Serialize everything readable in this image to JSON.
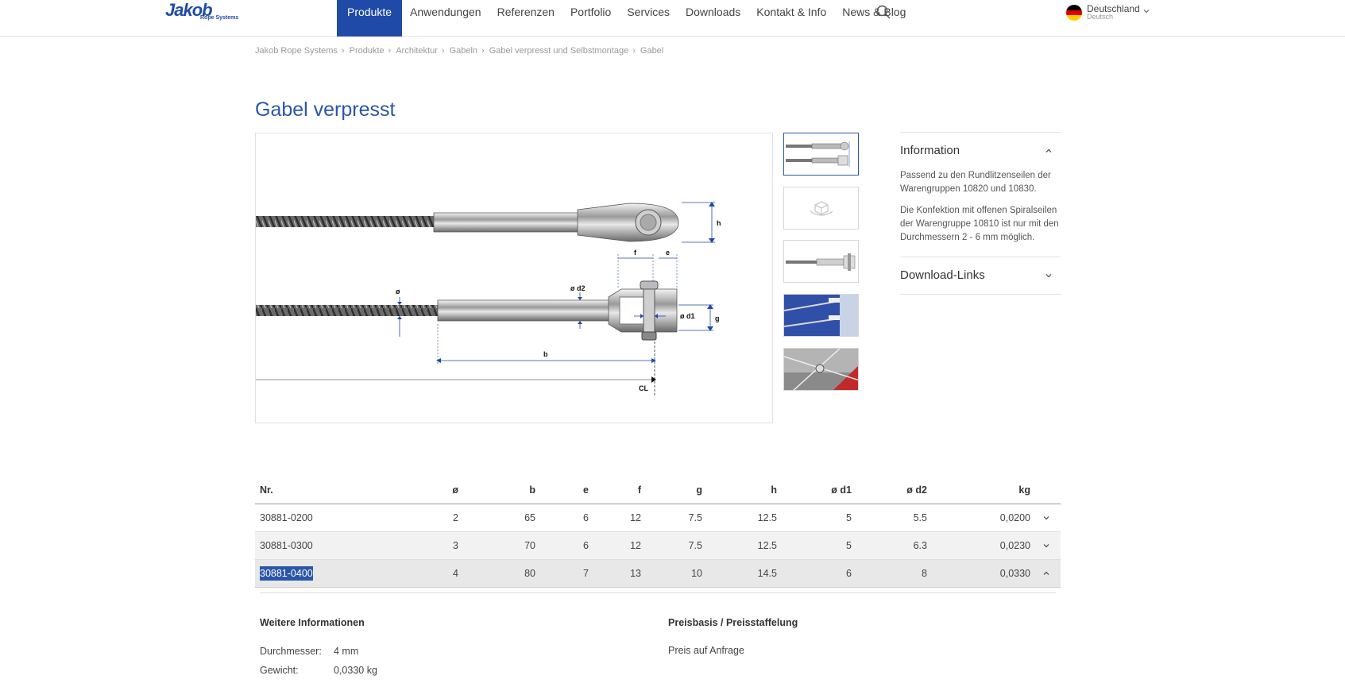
{
  "header": {
    "logo": {
      "name": "Jakob",
      "tagline": "Rope Systems"
    },
    "nav": [
      "Produkte",
      "Anwendungen",
      "Referenzen",
      "Portfolio",
      "Services",
      "Downloads",
      "Kontakt & Info",
      "News & Blog"
    ],
    "active_nav": "Produkte",
    "language": {
      "country": "Deutschland",
      "language": "Deutsch"
    }
  },
  "breadcrumb": [
    "Jakob Rope Systems",
    "Produkte",
    "Architektur",
    "Gabeln",
    "Gabel verpresst und Selbstmontage",
    "Gabel"
  ],
  "page_title": "Gabel verpresst",
  "drawing_labels": {
    "h": "h",
    "f": "f",
    "e": "e",
    "d2": "ø d2",
    "d1": "ø d1",
    "g": "g",
    "dia": "ø",
    "b": "b",
    "cl": "CL"
  },
  "info": {
    "information_title": "Information",
    "paragraphs": [
      "Passend zu den Rundlitzenseilen der Warengruppen 10820 und 10830.",
      "Die Konfektion mit offenen Spiralseilen der Warengruppe 10810 ist nur mit den Durchmessern 2 - 6 mm möglich."
    ],
    "download_title": "Download-Links"
  },
  "table": {
    "headers": [
      "Nr.",
      "ø",
      "b",
      "e",
      "f",
      "g",
      "h",
      "ø d1",
      "ø d2",
      "kg"
    ],
    "rows": [
      [
        "30881-0200",
        "2",
        "65",
        "6",
        "12",
        "7.5",
        "12.5",
        "5",
        "5.5",
        "0,0200"
      ],
      [
        "30881-0300",
        "3",
        "70",
        "6",
        "12",
        "7.5",
        "12.5",
        "5",
        "6.3",
        "0,0230"
      ],
      [
        "30881-0400",
        "4",
        "80",
        "7",
        "13",
        "10",
        "14.5",
        "6",
        "8",
        "0,0330"
      ]
    ]
  },
  "details": {
    "more_info_title": "Weitere Informationen",
    "diameter_label": "Durchmesser:",
    "diameter_value": "4 mm",
    "weight_label": "Gewicht:",
    "weight_value": "0,0330 kg",
    "price_title": "Preisbasis / Preisstaffelung",
    "price_value": "Preis auf Anfrage"
  },
  "colors": {
    "brand": "#1f4aa8",
    "title": "#2b56a8"
  }
}
